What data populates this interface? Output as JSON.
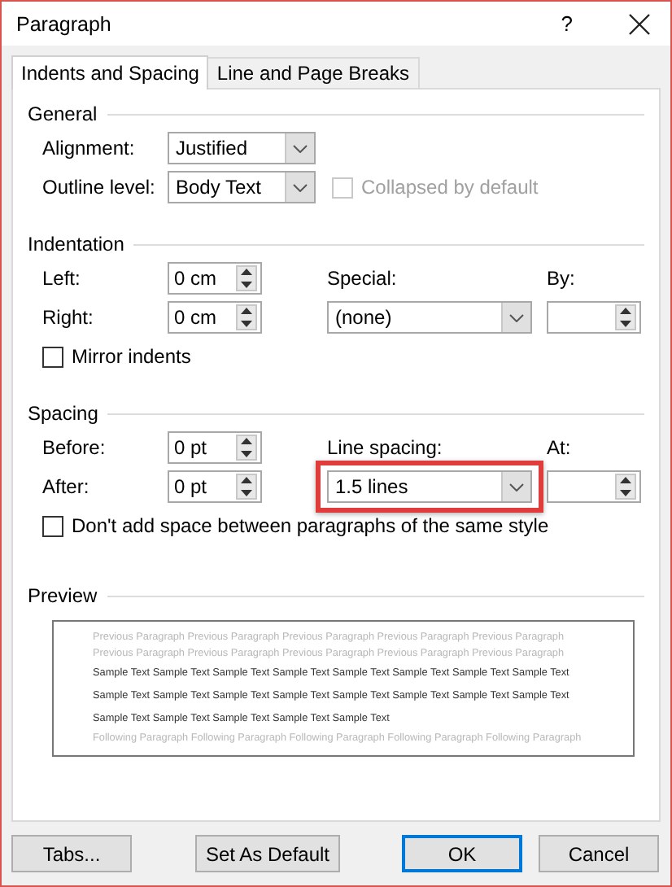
{
  "window": {
    "title": "Paragraph",
    "help": "?"
  },
  "tabs": [
    {
      "label": "Indents and Spacing",
      "selected": true
    },
    {
      "label": "Line and Page Breaks",
      "selected": false
    }
  ],
  "general": {
    "heading": "General",
    "alignment": {
      "label": "Alignment:",
      "value": "Justified"
    },
    "outline_level": {
      "label": "Outline level:",
      "value": "Body Text"
    },
    "collapsed": {
      "label": "Collapsed by default",
      "checked": false,
      "disabled": true
    }
  },
  "indentation": {
    "heading": "Indentation",
    "left": {
      "label": "Left:",
      "value": "0 cm"
    },
    "right": {
      "label": "Right:",
      "value": "0 cm"
    },
    "special": {
      "label": "Special:",
      "value": "(none)"
    },
    "by": {
      "label": "By:"
    },
    "mirror": {
      "label": "Mirror indents",
      "checked": false,
      "disabled": false
    }
  },
  "spacing": {
    "heading": "Spacing",
    "before": {
      "label": "Before:",
      "value": "0 pt"
    },
    "after": {
      "label": "After:",
      "value": "0 pt"
    },
    "line_spacing": {
      "label": "Line spacing:",
      "value": "1.5 lines",
      "highlighted": true
    },
    "at": {
      "label": "At:"
    },
    "no_space": {
      "label": "Don't add space between paragraphs of the same style",
      "checked": false,
      "disabled": false
    }
  },
  "preview": {
    "heading": "Preview",
    "lines": [
      {
        "kind": "previous",
        "text": "Previous Paragraph Previous Paragraph Previous Paragraph Previous Paragraph Previous Paragraph"
      },
      {
        "kind": "previous",
        "text": "Previous Paragraph Previous Paragraph Previous Paragraph Previous Paragraph Previous Paragraph"
      },
      {
        "kind": "sample",
        "text": "Sample Text Sample Text Sample Text Sample Text Sample Text Sample Text Sample Text Sample Text"
      },
      {
        "kind": "sample",
        "text": "Sample Text Sample Text Sample Text Sample Text Sample Text Sample Text Sample Text Sample Text"
      },
      {
        "kind": "sample",
        "text": "Sample Text Sample Text Sample Text Sample Text Sample Text"
      },
      {
        "kind": "following",
        "text": "Following Paragraph Following Paragraph Following Paragraph Following Paragraph Following Paragraph"
      }
    ]
  },
  "buttons": [
    {
      "label": "Tabs...",
      "default": false
    },
    {
      "label": "Set As Default",
      "default": false
    },
    {
      "label": "OK",
      "default": true
    },
    {
      "label": "Cancel",
      "default": false
    }
  ]
}
